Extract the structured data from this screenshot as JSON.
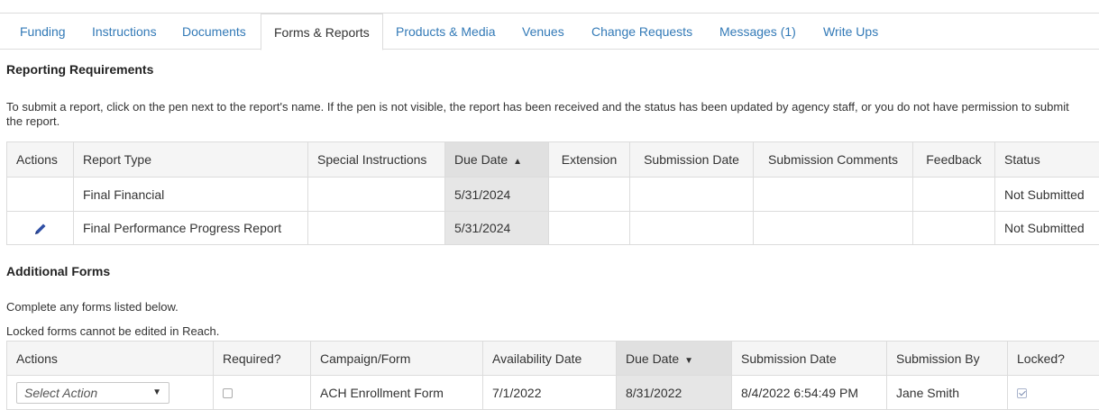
{
  "tabs": [
    {
      "label": "Funding"
    },
    {
      "label": "Instructions"
    },
    {
      "label": "Documents"
    },
    {
      "label": "Forms & Reports"
    },
    {
      "label": "Products & Media"
    },
    {
      "label": "Venues"
    },
    {
      "label": "Change Requests"
    },
    {
      "label": "Messages (1)"
    },
    {
      "label": "Write Ups"
    }
  ],
  "reporting": {
    "title": "Reporting Requirements",
    "description": "To submit a report, click on the pen next to the report's name. If the pen is not visible, the report has been received and the status has been updated by agency staff, or you do not have permission to submit the report.",
    "headers": {
      "actions": "Actions",
      "report_type": "Report Type",
      "special_instructions": "Special Instructions",
      "due_date": "Due Date",
      "due_date_sort": "▲",
      "extension": "Extension",
      "submission_date": "Submission Date",
      "submission_comments": "Submission Comments",
      "feedback": "Feedback",
      "status": "Status"
    },
    "rows": [
      {
        "report_type": "Final Financial",
        "special_instructions": "",
        "due_date": "5/31/2024",
        "extension": "",
        "submission_date": "",
        "submission_comments": "",
        "feedback": "",
        "status": "Not Submitted",
        "editable": false
      },
      {
        "report_type": "Final Performance Progress Report",
        "special_instructions": "",
        "due_date": "5/31/2024",
        "extension": "",
        "submission_date": "",
        "submission_comments": "",
        "feedback": "",
        "status": "Not Submitted",
        "editable": true
      }
    ]
  },
  "additional": {
    "title": "Additional Forms",
    "line1": "Complete any forms listed below.",
    "line2": "Locked forms cannot be edited in Reach.",
    "headers": {
      "actions": "Actions",
      "required": "Required?",
      "campaign_form": "Campaign/Form",
      "availability_date": "Availability Date",
      "due_date": "Due Date",
      "due_date_sort": "▼",
      "submission_date": "Submission Date",
      "submission_by": "Submission By",
      "locked": "Locked?"
    },
    "rows": [
      {
        "action_select": "Select Action",
        "action_caret": "▼",
        "required": false,
        "campaign_form": "ACH Enrollment Form",
        "availability_date": "7/1/2022",
        "due_date": "8/31/2022",
        "submission_date": "8/4/2022 6:54:49 PM",
        "submission_by": "Jane Smith",
        "locked": true
      }
    ]
  },
  "colors": {
    "link": "#337ab7",
    "pen": "#2f4fa5",
    "sorted_col": "#e6e6e6"
  }
}
